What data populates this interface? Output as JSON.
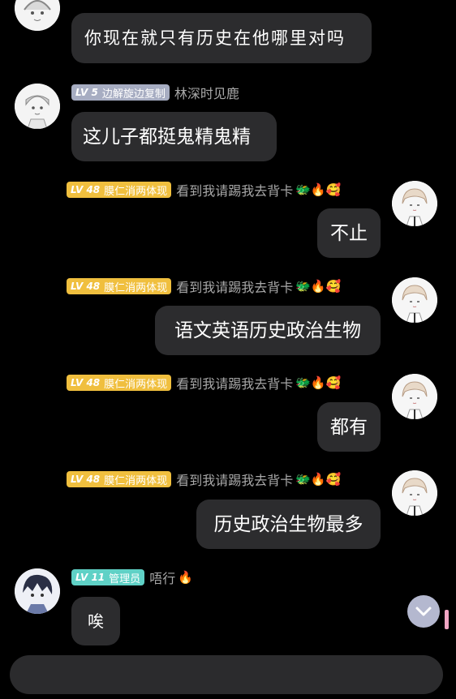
{
  "messages": [
    {
      "side": "left",
      "avatar": "avatar-boy-sketch",
      "text": "你现在就只有历史在他哪里对吗",
      "partial": true
    },
    {
      "side": "left",
      "avatar": "avatar-boy-sketch",
      "badge": {
        "level": "LV 5",
        "title": "边解旋边复制",
        "color": "#a7adc2"
      },
      "name": "林深时见鹿",
      "emoji": "",
      "text": "这儿子都挺鬼精鬼精"
    },
    {
      "side": "right",
      "avatar": "avatar-girl-sketch",
      "badge": {
        "level": "LV 48",
        "title": "膜仁消两体现",
        "color": "#f0bf3e"
      },
      "name": "看到我请踢我去背卡",
      "emoji": "🐲🔥🥰",
      "text": "不止"
    },
    {
      "side": "right",
      "avatar": "avatar-girl-sketch",
      "badge": {
        "level": "LV 48",
        "title": "膜仁消两体现",
        "color": "#f0bf3e"
      },
      "name": "看到我请踢我去背卡",
      "emoji": "🐲🔥🥰",
      "text": "语文英语历史政治生物"
    },
    {
      "side": "right",
      "avatar": "avatar-girl-sketch",
      "badge": {
        "level": "LV 48",
        "title": "膜仁消两体现",
        "color": "#f0bf3e"
      },
      "name": "看到我请踢我去背卡",
      "emoji": "🐲🔥🥰",
      "text": "都有"
    },
    {
      "side": "right",
      "avatar": "avatar-girl-sketch",
      "badge": {
        "level": "LV 48",
        "title": "膜仁消两体现",
        "color": "#f0bf3e"
      },
      "name": "看到我请踢我去背卡",
      "emoji": "🐲🔥🥰",
      "text": "历史政治生物最多"
    },
    {
      "side": "left",
      "avatar": "avatar-anime-boy",
      "badge": {
        "level": "LV 11",
        "title": "管理员",
        "color": "#5fd1c6"
      },
      "name": "唔行",
      "emoji": "🔥",
      "text": "唉"
    }
  ],
  "scroll_button": {
    "icon": "chevron-down-icon"
  },
  "input": {
    "placeholder": ""
  }
}
